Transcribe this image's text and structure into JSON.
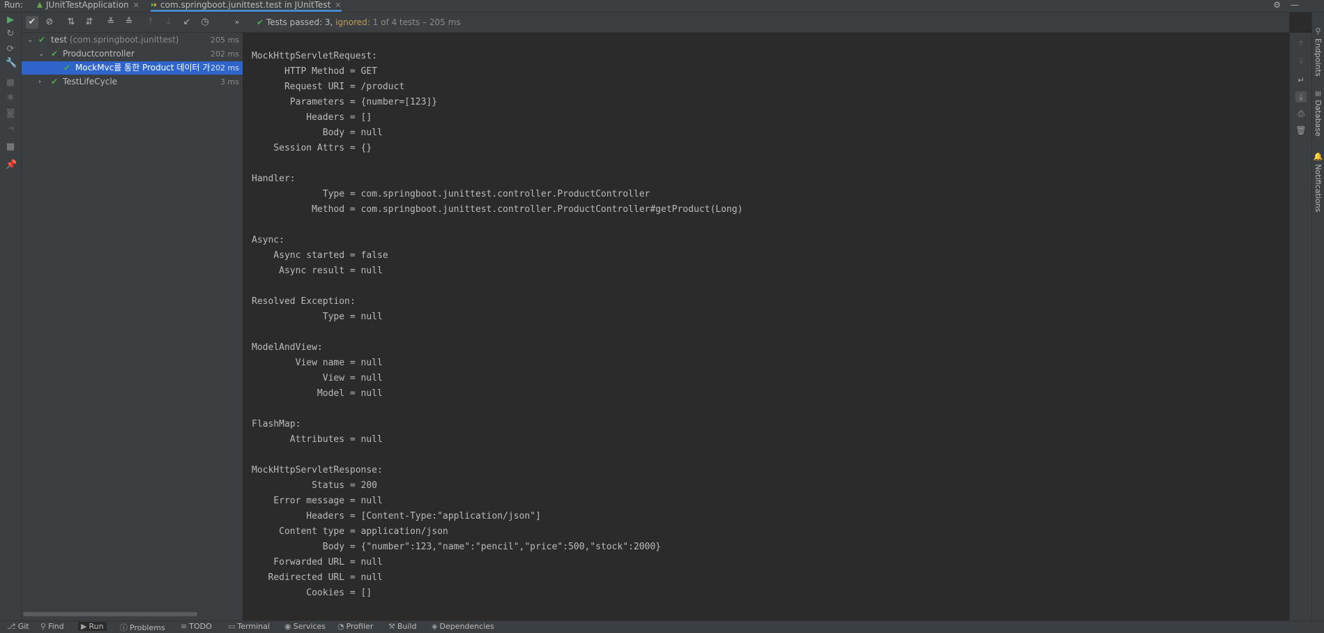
{
  "run_tabs": {
    "run_label": "Run:",
    "tabs": [
      {
        "label": "JUnitTestApplication",
        "icon": "spring-run-icon"
      },
      {
        "label": "com.springboot.junittest.test in JUnitTest",
        "icon": "test-tree-icon",
        "active": true
      }
    ]
  },
  "test_status": {
    "passed": "Tests passed: 3,",
    "ignored": "ignored:",
    "summary": "1 of 4 tests – 205 ms"
  },
  "tree": [
    {
      "label": "test",
      "pkg": "(com.springboot.junittest)",
      "time": "205 ms",
      "expanded": true
    },
    {
      "label": "Productcontroller",
      "time": "202 ms",
      "expanded": true
    },
    {
      "label": "MockMvc를 통한 Product 데이터 가",
      "time": "202 ms",
      "selected": true
    },
    {
      "label": "TestLifeCycle",
      "time": "3 ms",
      "expanded": false
    }
  ],
  "console_lines": [
    "MockHttpServletRequest:",
    "      HTTP Method = GET",
    "      Request URI = /product",
    "       Parameters = {number=[123]}",
    "          Headers = []",
    "             Body = null",
    "    Session Attrs = {}",
    "",
    "Handler:",
    "             Type = com.springboot.junittest.controller.ProductController",
    "           Method = com.springboot.junittest.controller.ProductController#getProduct(Long)",
    "",
    "Async:",
    "    Async started = false",
    "     Async result = null",
    "",
    "Resolved Exception:",
    "             Type = null",
    "",
    "ModelAndView:",
    "        View name = null",
    "             View = null",
    "            Model = null",
    "",
    "FlashMap:",
    "       Attributes = null",
    "",
    "MockHttpServletResponse:",
    "           Status = 200",
    "    Error message = null",
    "          Headers = [Content-Type:\"application/json\"]",
    "     Content type = application/json",
    "             Body = {\"number\":123,\"name\":\"pencil\",\"price\":500,\"stock\":2000}",
    "    Forwarded URL = null",
    "   Redirected URL = null",
    "          Cookies = []"
  ],
  "side_tools": [
    {
      "label": "Endpoints",
      "icon": "endpoints-icon"
    },
    {
      "label": "Database",
      "icon": "database-icon"
    },
    {
      "label": "Notifications",
      "icon": "bell-icon"
    }
  ],
  "bottom_tools": [
    {
      "label": "Git",
      "icon": "git-icon"
    },
    {
      "label": "Find",
      "icon": "search-icon"
    },
    {
      "label": "Run",
      "icon": "run-icon",
      "active": true
    },
    {
      "label": "Problems",
      "icon": "problems-icon"
    },
    {
      "label": "TODO",
      "icon": "todo-icon"
    },
    {
      "label": "Terminal",
      "icon": "terminal-icon"
    },
    {
      "label": "Services",
      "icon": "services-icon"
    },
    {
      "label": "Profiler",
      "icon": "profiler-icon"
    },
    {
      "label": "Build",
      "icon": "build-icon"
    },
    {
      "label": "Dependencies",
      "icon": "dependencies-icon"
    }
  ],
  "colors": {
    "accent": "#2f65ca",
    "pass_green": "#4fa94a",
    "ignored": "#bf9c57",
    "panel_bg": "#3c3f41",
    "console_bg": "#2b2b2b"
  }
}
